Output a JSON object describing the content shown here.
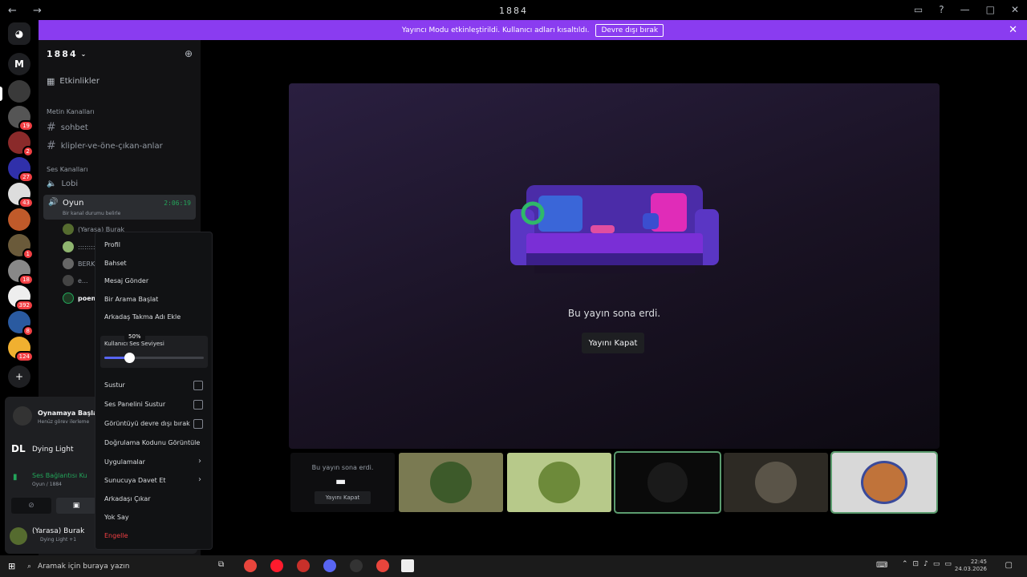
{
  "window": {
    "title": "1884",
    "nav": "← →"
  },
  "banner": {
    "text": "Yayıncı Modu etkinleştirildi. Kullanıcı adları kısaltıldı.",
    "button": "Devre dışı bırak"
  },
  "server": {
    "name": "1884",
    "events": "Etkinlikler",
    "text_category": "Metin Kanalları",
    "text_channels": [
      "sohbet",
      "klipler-ve-öne-çıkan-anlar"
    ],
    "voice_category": "Ses Kanalları",
    "voice_channels": [
      "Lobi",
      "Oyun"
    ],
    "active_voice": {
      "name": "Oyun",
      "timer": "2:06:19",
      "status": "Bir kanal durumu belirle"
    },
    "voice_users": [
      "(Yarasa) Burak",
      "::::::::",
      "BERKE",
      "e...",
      "poem"
    ]
  },
  "guild_badges": [
    "19",
    "2",
    "27",
    "43",
    "1",
    "18",
    "392",
    "8",
    "124"
  ],
  "user_panel": {
    "activity_title": "Oynamaya Başla!",
    "activity_sub": "Henüz görev ilerleme",
    "game": "Dying Light",
    "connection": "Ses Bağlantısı Ku",
    "connection_sub": "Oyun / 1884",
    "username": "(Yarasa) Burak",
    "user_status": "Dying Light +1"
  },
  "stage": {
    "message": "Bu yayın sona erdi.",
    "button": "Yayını Kapat"
  },
  "thumb_first": {
    "message": "Bu yayın sona erdi.",
    "button": "Yayını Kapat"
  },
  "context_menu": {
    "items_top": [
      "Profil",
      "Bahset",
      "Mesaj Gönder",
      "Bir Arama Başlat",
      "Arkadaş Takma Adı Ekle"
    ],
    "volume_label": "Kullanıcı Ses Seviyesi",
    "volume_tooltip": "50%",
    "volume_value": 0.25,
    "checks": [
      "Sustur",
      "Ses Panelini Sustur",
      "Görüntüyü devre dışı bırak"
    ],
    "items_bottom": [
      "Doğrulama Kodunu Görüntüle",
      "Uygulamalar",
      "Sunucuya Davet Et",
      "Arkadaşı Çıkar",
      "Yok Say"
    ],
    "danger": "Engelle"
  },
  "taskbar": {
    "search": "Aramak için buraya yazın",
    "time": "22:45",
    "date": "24.03.2026"
  },
  "colors": {
    "accent": "#8a3cf0",
    "danger": "#f23f43",
    "online": "#23a55a"
  }
}
